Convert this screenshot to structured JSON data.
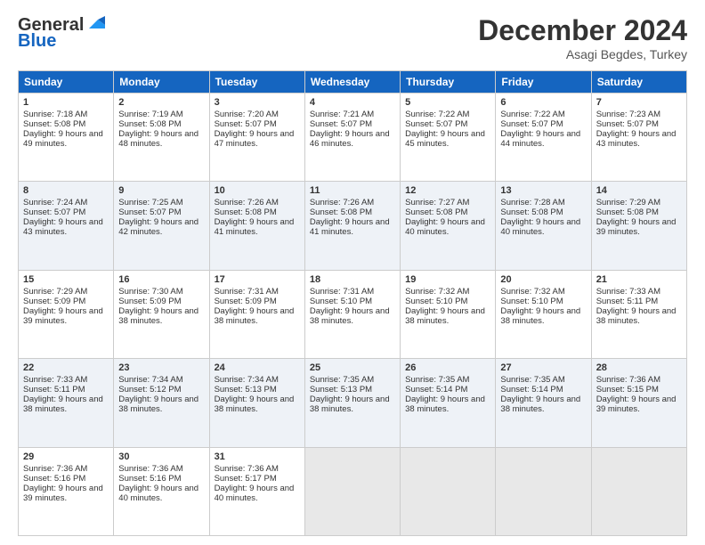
{
  "header": {
    "logo_line1": "General",
    "logo_line2": "Blue",
    "month": "December 2024",
    "location": "Asagi Begdes, Turkey"
  },
  "weekdays": [
    "Sunday",
    "Monday",
    "Tuesday",
    "Wednesday",
    "Thursday",
    "Friday",
    "Saturday"
  ],
  "weeks": [
    [
      {
        "day": "1",
        "sunrise": "7:18 AM",
        "sunset": "5:08 PM",
        "daylight": "9 hours and 49 minutes."
      },
      {
        "day": "2",
        "sunrise": "7:19 AM",
        "sunset": "5:08 PM",
        "daylight": "9 hours and 48 minutes."
      },
      {
        "day": "3",
        "sunrise": "7:20 AM",
        "sunset": "5:07 PM",
        "daylight": "9 hours and 47 minutes."
      },
      {
        "day": "4",
        "sunrise": "7:21 AM",
        "sunset": "5:07 PM",
        "daylight": "9 hours and 46 minutes."
      },
      {
        "day": "5",
        "sunrise": "7:22 AM",
        "sunset": "5:07 PM",
        "daylight": "9 hours and 45 minutes."
      },
      {
        "day": "6",
        "sunrise": "7:22 AM",
        "sunset": "5:07 PM",
        "daylight": "9 hours and 44 minutes."
      },
      {
        "day": "7",
        "sunrise": "7:23 AM",
        "sunset": "5:07 PM",
        "daylight": "9 hours and 43 minutes."
      }
    ],
    [
      {
        "day": "8",
        "sunrise": "7:24 AM",
        "sunset": "5:07 PM",
        "daylight": "9 hours and 43 minutes."
      },
      {
        "day": "9",
        "sunrise": "7:25 AM",
        "sunset": "5:07 PM",
        "daylight": "9 hours and 42 minutes."
      },
      {
        "day": "10",
        "sunrise": "7:26 AM",
        "sunset": "5:08 PM",
        "daylight": "9 hours and 41 minutes."
      },
      {
        "day": "11",
        "sunrise": "7:26 AM",
        "sunset": "5:08 PM",
        "daylight": "9 hours and 41 minutes."
      },
      {
        "day": "12",
        "sunrise": "7:27 AM",
        "sunset": "5:08 PM",
        "daylight": "9 hours and 40 minutes."
      },
      {
        "day": "13",
        "sunrise": "7:28 AM",
        "sunset": "5:08 PM",
        "daylight": "9 hours and 40 minutes."
      },
      {
        "day": "14",
        "sunrise": "7:29 AM",
        "sunset": "5:08 PM",
        "daylight": "9 hours and 39 minutes."
      }
    ],
    [
      {
        "day": "15",
        "sunrise": "7:29 AM",
        "sunset": "5:09 PM",
        "daylight": "9 hours and 39 minutes."
      },
      {
        "day": "16",
        "sunrise": "7:30 AM",
        "sunset": "5:09 PM",
        "daylight": "9 hours and 38 minutes."
      },
      {
        "day": "17",
        "sunrise": "7:31 AM",
        "sunset": "5:09 PM",
        "daylight": "9 hours and 38 minutes."
      },
      {
        "day": "18",
        "sunrise": "7:31 AM",
        "sunset": "5:10 PM",
        "daylight": "9 hours and 38 minutes."
      },
      {
        "day": "19",
        "sunrise": "7:32 AM",
        "sunset": "5:10 PM",
        "daylight": "9 hours and 38 minutes."
      },
      {
        "day": "20",
        "sunrise": "7:32 AM",
        "sunset": "5:10 PM",
        "daylight": "9 hours and 38 minutes."
      },
      {
        "day": "21",
        "sunrise": "7:33 AM",
        "sunset": "5:11 PM",
        "daylight": "9 hours and 38 minutes."
      }
    ],
    [
      {
        "day": "22",
        "sunrise": "7:33 AM",
        "sunset": "5:11 PM",
        "daylight": "9 hours and 38 minutes."
      },
      {
        "day": "23",
        "sunrise": "7:34 AM",
        "sunset": "5:12 PM",
        "daylight": "9 hours and 38 minutes."
      },
      {
        "day": "24",
        "sunrise": "7:34 AM",
        "sunset": "5:13 PM",
        "daylight": "9 hours and 38 minutes."
      },
      {
        "day": "25",
        "sunrise": "7:35 AM",
        "sunset": "5:13 PM",
        "daylight": "9 hours and 38 minutes."
      },
      {
        "day": "26",
        "sunrise": "7:35 AM",
        "sunset": "5:14 PM",
        "daylight": "9 hours and 38 minutes."
      },
      {
        "day": "27",
        "sunrise": "7:35 AM",
        "sunset": "5:14 PM",
        "daylight": "9 hours and 38 minutes."
      },
      {
        "day": "28",
        "sunrise": "7:36 AM",
        "sunset": "5:15 PM",
        "daylight": "9 hours and 39 minutes."
      }
    ],
    [
      {
        "day": "29",
        "sunrise": "7:36 AM",
        "sunset": "5:16 PM",
        "daylight": "9 hours and 39 minutes."
      },
      {
        "day": "30",
        "sunrise": "7:36 AM",
        "sunset": "5:16 PM",
        "daylight": "9 hours and 40 minutes."
      },
      {
        "day": "31",
        "sunrise": "7:36 AM",
        "sunset": "5:17 PM",
        "daylight": "9 hours and 40 minutes."
      },
      null,
      null,
      null,
      null
    ]
  ],
  "labels": {
    "sunrise": "Sunrise:",
    "sunset": "Sunset:",
    "daylight": "Daylight:"
  }
}
